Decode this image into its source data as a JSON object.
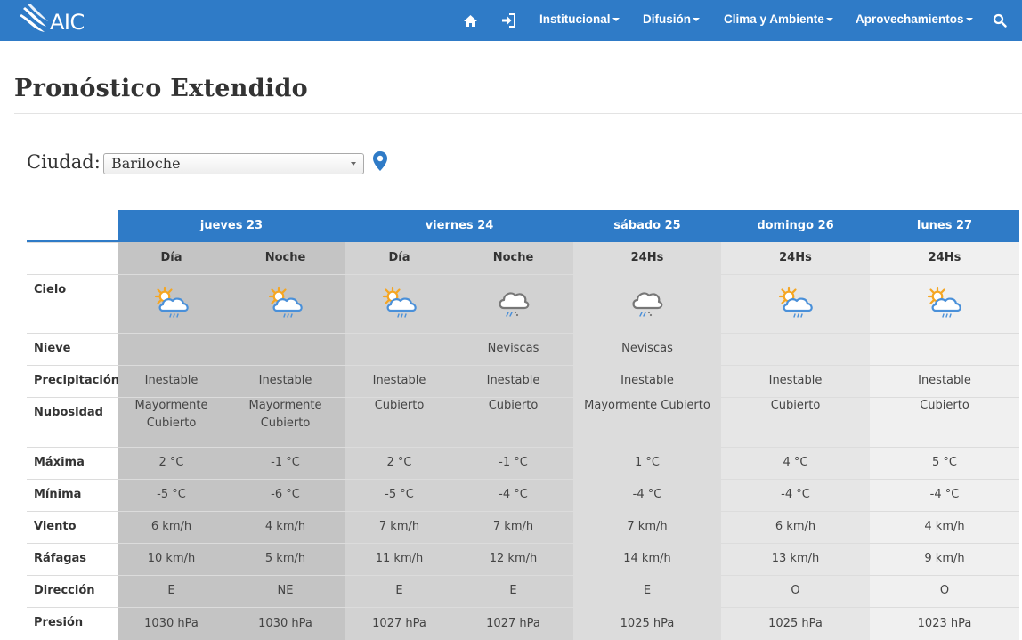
{
  "nav": {
    "logo_text": "AIC",
    "items": [
      {
        "label": "Institucional",
        "has_caret": true
      },
      {
        "label": "Difusión",
        "has_caret": true
      },
      {
        "label": "Clima y Ambiente",
        "has_caret": true
      },
      {
        "label": "Aprovechamientos",
        "has_caret": true
      }
    ],
    "icons": [
      "home-icon",
      "login-icon",
      "search-icon"
    ],
    "color": "#2f7bc7"
  },
  "page": {
    "title": "Pronóstico Extendido"
  },
  "city": {
    "label": "Ciudad:",
    "selected": "Bariloche",
    "pin_icon": "map-marker-icon"
  },
  "forecast": {
    "days": [
      {
        "label": "jueves 23"
      },
      {
        "label": "viernes 24"
      },
      {
        "label": "sábado 25"
      },
      {
        "label": "domingo 26"
      },
      {
        "label": "lunes 27"
      }
    ],
    "row_labels": {
      "cielo": "Cielo",
      "nieve": "Nieve",
      "precipitacion": "Precipitación",
      "nubosidad": "Nubosidad",
      "maxima": "Máxima",
      "minima": "Mínima",
      "viento": "Viento",
      "rafagas": "Ráfagas",
      "direccion": "Dirección",
      "presion": "Presión"
    },
    "periods": [
      {
        "period": "Día",
        "sky_icon": "sun-cloud-rain-icon",
        "nieve": "",
        "precipitacion": "Inestable",
        "nubosidad": "Mayormente Cubierto",
        "maxima": "2 °C",
        "minima": "-5 °C",
        "viento": "6 km/h",
        "rafagas": "10 km/h",
        "direccion": "E",
        "presion": "1030 hPa"
      },
      {
        "period": "Noche",
        "sky_icon": "sun-cloud-rain-icon",
        "nieve": "",
        "precipitacion": "Inestable",
        "nubosidad": "Mayormente Cubierto",
        "maxima": "-1 °C",
        "minima": "-6 °C",
        "viento": "4 km/h",
        "rafagas": "5 km/h",
        "direccion": "NE",
        "presion": "1030 hPa"
      },
      {
        "period": "Día",
        "sky_icon": "sun-cloud-rain-icon",
        "nieve": "",
        "precipitacion": "Inestable",
        "nubosidad": "Cubierto",
        "maxima": "2 °C",
        "minima": "-5 °C",
        "viento": "7 km/h",
        "rafagas": "11 km/h",
        "direccion": "E",
        "presion": "1027 hPa"
      },
      {
        "period": "Noche",
        "sky_icon": "cloud-snow-icon",
        "nieve": "Neviscas",
        "precipitacion": "Inestable",
        "nubosidad": "Cubierto",
        "maxima": "-1 °C",
        "minima": "-4 °C",
        "viento": "7 km/h",
        "rafagas": "12 km/h",
        "direccion": "E",
        "presion": "1027 hPa"
      },
      {
        "period": "24Hs",
        "sky_icon": "cloud-snow-icon",
        "nieve": "Neviscas",
        "precipitacion": "Inestable",
        "nubosidad": "Mayormente Cubierto",
        "maxima": "1 °C",
        "minima": "-4 °C",
        "viento": "7 km/h",
        "rafagas": "14 km/h",
        "direccion": "E",
        "presion": "1025 hPa"
      },
      {
        "period": "24Hs",
        "sky_icon": "sun-cloud-rain-icon",
        "nieve": "",
        "precipitacion": "Inestable",
        "nubosidad": "Cubierto",
        "maxima": "4 °C",
        "minima": "-4 °C",
        "viento": "6 km/h",
        "rafagas": "13 km/h",
        "direccion": "O",
        "presion": "1025 hPa"
      },
      {
        "period": "24Hs",
        "sky_icon": "sun-cloud-rain-icon",
        "nieve": "",
        "precipitacion": "Inestable",
        "nubosidad": "Cubierto",
        "maxima": "5 °C",
        "minima": "-4 °C",
        "viento": "4 km/h",
        "rafagas": "9 km/h",
        "direccion": "O",
        "presion": "1023 hPa"
      }
    ],
    "column_shades": [
      "#c4c4c4",
      "#c4c4c4",
      "#d2d2d2",
      "#d2d2d2",
      "#dcdcdc",
      "#e6e6e6",
      "#f0f0f0"
    ],
    "header_color": "#2f7bc7"
  }
}
